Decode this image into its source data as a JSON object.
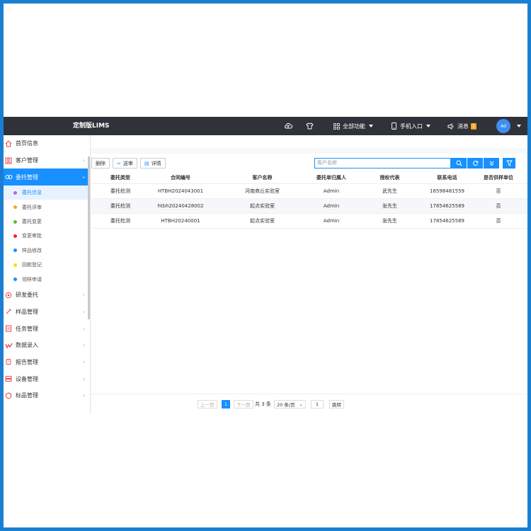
{
  "app": {
    "title": "定制版LIMS"
  },
  "topbar": {
    "all_functions": "全部功能",
    "mobile_entry": "手机入口",
    "messages": "消息",
    "message_badge": "1",
    "avatar_text": "Ad"
  },
  "sidebar": {
    "items": [
      {
        "label": "首页信息",
        "icon": "home-icon",
        "color": "#e64545"
      },
      {
        "label": "客户管理",
        "icon": "customer-icon",
        "color": "#e64545"
      },
      {
        "label": "委托管理",
        "icon": "commission-icon",
        "color": "#ffffff"
      },
      {
        "label": "研发委托",
        "icon": "research-icon",
        "color": "#e64545"
      },
      {
        "label": "样品管理",
        "icon": "sample-icon",
        "color": "#e64545"
      },
      {
        "label": "任务管理",
        "icon": "task-icon",
        "color": "#e64545"
      },
      {
        "label": "数据录入",
        "icon": "data-icon",
        "color": "#e64545"
      },
      {
        "label": "报告管理",
        "icon": "report-icon",
        "color": "#e64545"
      },
      {
        "label": "设备管理",
        "icon": "equipment-icon",
        "color": "#e64545"
      },
      {
        "label": "标品管理",
        "icon": "standard-icon",
        "color": "#e64545"
      }
    ],
    "sub_items": [
      {
        "label": "委托信息",
        "color": "#b06ad6"
      },
      {
        "label": "委托评审",
        "color": "#f5a623"
      },
      {
        "label": "委托变更",
        "color": "#52c41a"
      },
      {
        "label": "变更审批",
        "color": "#f5222d"
      },
      {
        "label": "样品修改",
        "color": "#1890ff"
      },
      {
        "label": "回款登记",
        "color": "#fadb14"
      },
      {
        "label": "领样申请",
        "color": "#1890ff"
      }
    ]
  },
  "toolbar": {
    "delete_label": "删除",
    "submit_label": "送审",
    "detail_label": "详情",
    "search_placeholder": "客户名称"
  },
  "table": {
    "headers": [
      "委托类型",
      "合同编号",
      "客户名称",
      "委托单归属人",
      "授权代表",
      "联系电话",
      "是否供样单位"
    ],
    "rows": [
      [
        "委托检测",
        "HTBH2024043001",
        "河南商丘实验室",
        "Admin",
        "武先生",
        "16598481559",
        "否"
      ],
      [
        "委托检测",
        "htbh20240428002",
        "起点实验室",
        "Admin",
        "张先生",
        "17854625589",
        "否"
      ],
      [
        "委托检测",
        "HTBH20240001",
        "起点实验室",
        "Admin",
        "张先生",
        "17854625589",
        "否"
      ]
    ]
  },
  "pager": {
    "prev": "上一页",
    "current": "1",
    "next": "下一页",
    "total": "共 3 条",
    "page_size": "20 条/页",
    "jump_value": "1",
    "jump_label": "跳转"
  }
}
